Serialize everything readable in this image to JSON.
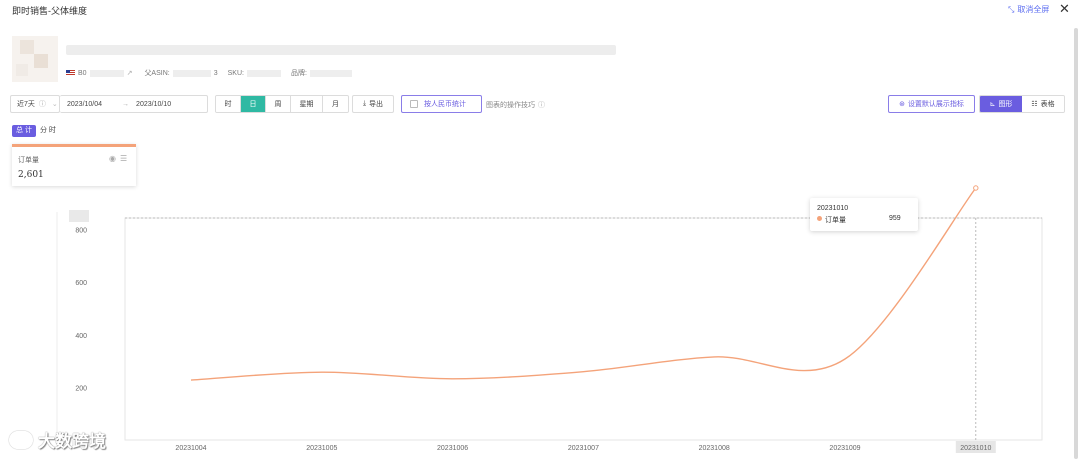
{
  "window": {
    "title": "即时销售-父体维度",
    "exit_fullscreen": "取消全屏",
    "close_symbol": "✕"
  },
  "product": {
    "asin_prefix": "B0",
    "parent_asin_label": "父ASIN: ",
    "parent_asin_tail": "3",
    "sku_label": "SKU: ",
    "brand_label": "品牌: "
  },
  "toolbar": {
    "range": "近7天",
    "date_start": "2023/10/04",
    "date_arrow": "→",
    "date_end": "2023/10/10",
    "granularity": [
      {
        "label": "时",
        "active": false
      },
      {
        "label": "日",
        "active": true
      },
      {
        "label": "周",
        "active": false
      },
      {
        "label": "星期",
        "active": false
      },
      {
        "label": "月",
        "active": false
      }
    ],
    "export": "导出",
    "rmb_checkbox": "按人民币统计",
    "tips": "图表的操作技巧",
    "set_default": "设置默认展示指标",
    "view_chart": "图形",
    "view_table": "表格"
  },
  "summary_toggle": [
    {
      "label": "总 计",
      "active": true
    },
    {
      "label": "分 时",
      "active": false
    }
  ],
  "metric_card": {
    "name": "订单量",
    "value": "2,601"
  },
  "tooltip": {
    "date": "20231010",
    "series": "订单量",
    "value": "959"
  },
  "watermark": "大数跨境",
  "colors": {
    "accent": "#6a5de0",
    "active_gran": "#2fb9a3",
    "series": "#f4a37a"
  },
  "chart_data": {
    "type": "line",
    "x": [
      "20231004",
      "20231005",
      "20231006",
      "20231007",
      "20231008",
      "20231009",
      "20231010"
    ],
    "series": [
      {
        "name": "订单量",
        "values": [
          230,
          260,
          235,
          262,
          318,
          310,
          959
        ]
      }
    ],
    "y_ticks": [
      200,
      400,
      600,
      800
    ],
    "ylim": [
      0,
      1000
    ],
    "highlight_x": "20231010",
    "grid": false,
    "legend": "none"
  }
}
